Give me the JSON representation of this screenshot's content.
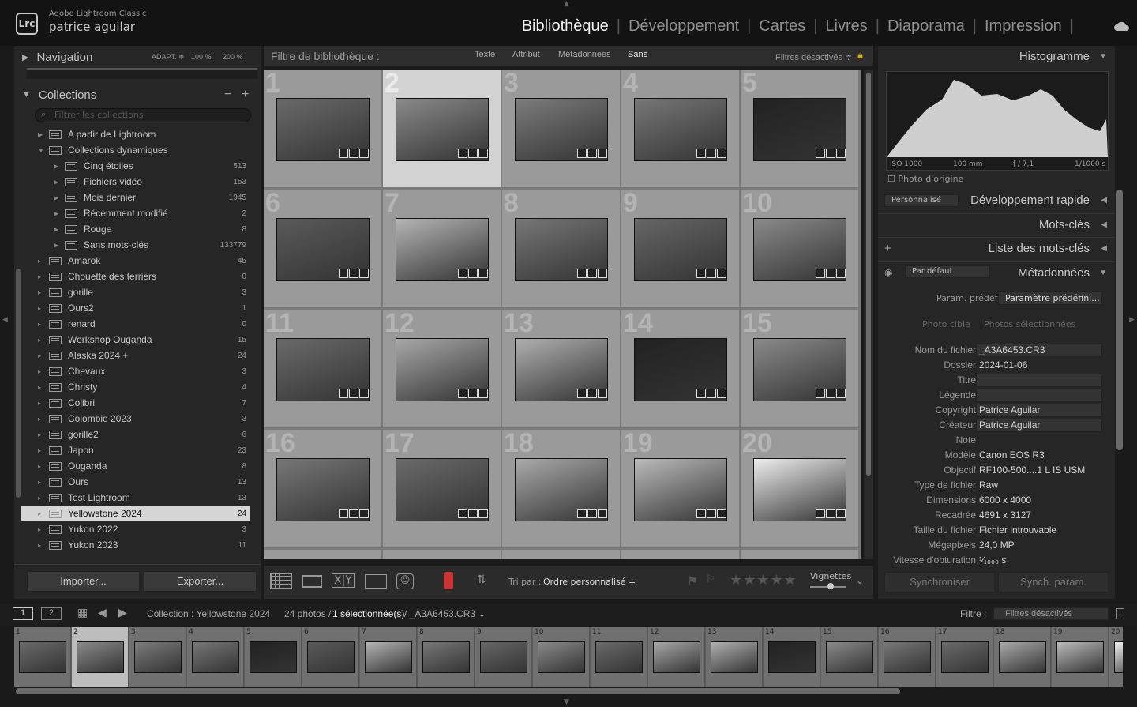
{
  "app": {
    "name": "Adobe Lightroom Classic",
    "user": "patrice aguilar",
    "logo": "Lrc"
  },
  "modules": [
    {
      "label": "Bibliothèque",
      "active": true
    },
    {
      "label": "Développement"
    },
    {
      "label": "Cartes"
    },
    {
      "label": "Livres"
    },
    {
      "label": "Diaporama"
    },
    {
      "label": "Impression"
    }
  ],
  "navigator": {
    "title": "Navigation",
    "zoom1": "ADAPT. ≑",
    "zoom2": "100 %",
    "zoom3": "200 %"
  },
  "collections": {
    "title": "Collections",
    "filter_placeholder": "Filtrer les collections",
    "items": [
      {
        "label": "A partir de Lightroom",
        "count": "",
        "indent": 1
      },
      {
        "label": "Collections dynamiques",
        "count": "",
        "indent": 1,
        "open": true
      },
      {
        "label": "Cinq étoiles",
        "count": "513",
        "indent": 2
      },
      {
        "label": "Fichiers vidéo",
        "count": "153",
        "indent": 2
      },
      {
        "label": "Mois dernier",
        "count": "1945",
        "indent": 2
      },
      {
        "label": "Récemment modifié",
        "count": "2",
        "indent": 2
      },
      {
        "label": "Rouge",
        "count": "8",
        "indent": 2
      },
      {
        "label": "Sans mots-clés",
        "count": "133779",
        "indent": 2
      },
      {
        "label": "Amarok",
        "count": "45",
        "indent": 0
      },
      {
        "label": "Chouette des terriers",
        "count": "0",
        "indent": 0
      },
      {
        "label": "gorille",
        "count": "3",
        "indent": 0
      },
      {
        "label": "Ours2",
        "count": "1",
        "indent": 0
      },
      {
        "label": "renard",
        "count": "0",
        "indent": 0
      },
      {
        "label": "Workshop Ouganda",
        "count": "15",
        "indent": 0
      },
      {
        "label": "Alaska 2024 +",
        "count": "24",
        "indent": 0
      },
      {
        "label": "Chevaux",
        "count": "3",
        "indent": 0
      },
      {
        "label": "Christy",
        "count": "4",
        "indent": 0
      },
      {
        "label": "Colibri",
        "count": "7",
        "indent": 0
      },
      {
        "label": "Colombie 2023",
        "count": "3",
        "indent": 0
      },
      {
        "label": "gorille2",
        "count": "6",
        "indent": 0
      },
      {
        "label": "Japon",
        "count": "23",
        "indent": 0
      },
      {
        "label": "Ouganda",
        "count": "8",
        "indent": 0
      },
      {
        "label": "Ours",
        "count": "13",
        "indent": 0
      },
      {
        "label": "Test Lightroom",
        "count": "13",
        "indent": 0
      },
      {
        "label": "Yellowstone 2024",
        "count": "24",
        "indent": 0,
        "selected": true
      },
      {
        "label": "Yukon 2022",
        "count": "3",
        "indent": 0
      },
      {
        "label": "Yukon 2023",
        "count": "11",
        "indent": 0
      }
    ]
  },
  "left_buttons": {
    "import": "Importer...",
    "export": "Exporter..."
  },
  "filterbar": {
    "title": "Filtre de bibliothèque :",
    "tabs": [
      "Texte",
      "Attribut",
      "Métadonnées",
      "Sans"
    ],
    "status": "Filtres désactivés ≑"
  },
  "grid": {
    "cells": [
      {
        "n": "1",
        "tone": "#6a6a6a"
      },
      {
        "n": "2",
        "tone": "#8a8a8a",
        "selected": true
      },
      {
        "n": "3",
        "tone": "#7c7c7c"
      },
      {
        "n": "4",
        "tone": "#777"
      },
      {
        "n": "5",
        "tone": "#222"
      },
      {
        "n": "6",
        "tone": "#5a5a5a"
      },
      {
        "n": "7",
        "tone": "#b5b5b5"
      },
      {
        "n": "8",
        "tone": "#777"
      },
      {
        "n": "9",
        "tone": "#666"
      },
      {
        "n": "10",
        "tone": "#8a8a8a"
      },
      {
        "n": "11",
        "tone": "#6a6a6a"
      },
      {
        "n": "12",
        "tone": "#a8a8a8"
      },
      {
        "n": "13",
        "tone": "#b0b0b0"
      },
      {
        "n": "14",
        "tone": "#222"
      },
      {
        "n": "15",
        "tone": "#8a8a8a"
      },
      {
        "n": "16",
        "tone": "#777"
      },
      {
        "n": "17",
        "tone": "#6a6a6a"
      },
      {
        "n": "18",
        "tone": "#aaa"
      },
      {
        "n": "19",
        "tone": "#bbb"
      },
      {
        "n": "20",
        "tone": "#eee"
      }
    ]
  },
  "toolbar": {
    "sort_label": "Tri par :",
    "sort_value": "Ordre personnalisé ≑",
    "thumb_label": "Vignettes"
  },
  "right": {
    "histogram": "Histogramme",
    "exif": [
      "ISO 1000",
      "100 mm",
      "ƒ / 7,1",
      "1/1000 s"
    ],
    "original": "Photo d'origine",
    "quick_preset": "Personnalisé",
    "quick_dev": "Développement rapide",
    "keywords": "Mots-clés",
    "keyword_list": "Liste des mots-clés",
    "meta_preset": "Par défaut",
    "metadata": "Métadonnées",
    "preset_label": "Param. prédéf.",
    "preset_value": "Paramètre prédéfini...",
    "target": "Photo cible",
    "selected": "Photos sélectionnées",
    "fields": [
      {
        "label": "Nom du fichier",
        "value": "_A3A6453.CR3",
        "box": true
      },
      {
        "label": "Dossier",
        "value": "2024-01-06"
      },
      {
        "label": "Titre",
        "value": "",
        "box": true
      },
      {
        "label": "Légende",
        "value": "",
        "box": true
      },
      {
        "label": "Copyright",
        "value": "Patrice Aguilar",
        "box": true
      },
      {
        "label": "Créateur",
        "value": "Patrice Aguilar",
        "box": true
      },
      {
        "label": "Note",
        "value": ""
      },
      {
        "label": "Modèle",
        "value": "Canon EOS R3"
      },
      {
        "label": "Objectif",
        "value": "RF100-500....1 L IS USM"
      },
      {
        "label": "Type de fichier",
        "value": "Raw"
      },
      {
        "label": "Dimensions",
        "value": "6000 x 4000"
      },
      {
        "label": "Recadrée",
        "value": "4691 x 3127"
      },
      {
        "label": "Taille du fichier",
        "value": "Fichier introuvable"
      },
      {
        "label": "Mégapixels",
        "value": "24,0 MP"
      },
      {
        "label": "Vitesse d'obturation",
        "value": "¹⁄₁₀₀₀ s"
      }
    ],
    "sync": "Synchroniser",
    "sync_settings": "Synch. param."
  },
  "filmstrip_bar": {
    "collection": "Collection : Yellowstone 2024",
    "count": "24 photos /",
    "selected": "1 sélectionnée(s)",
    "file": "/ _A3A6453.CR3 ⌄",
    "filter_label": "Filtre :",
    "filter_value": "Filtres désactivés"
  },
  "filmstrip": [
    "1",
    "2",
    "3",
    "4",
    "5",
    "6",
    "7",
    "8",
    "9",
    "10",
    "11",
    "12",
    "13",
    "14",
    "15",
    "16",
    "17",
    "18",
    "19",
    "20"
  ]
}
